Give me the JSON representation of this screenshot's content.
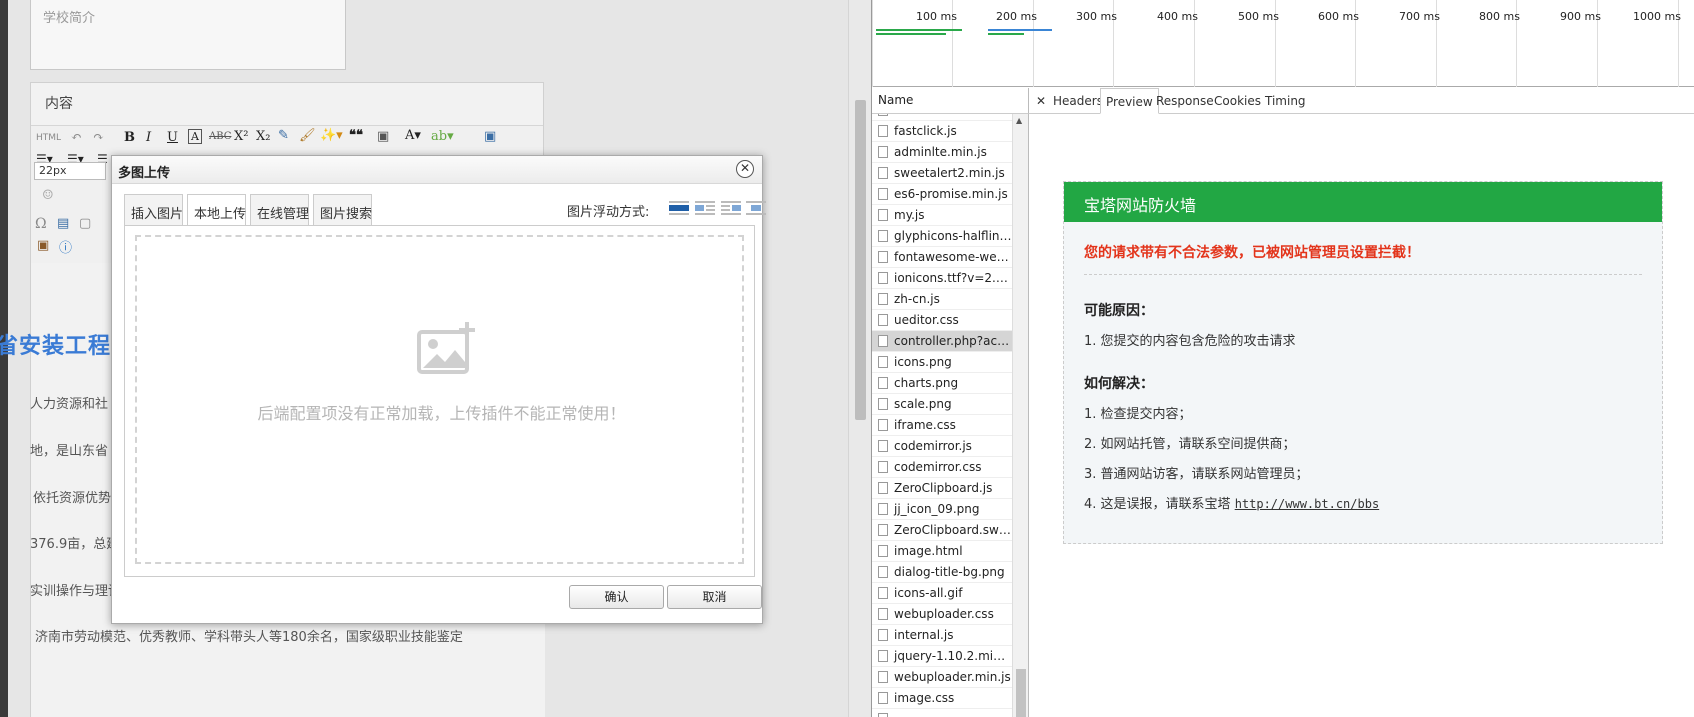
{
  "editor": {
    "intro_placeholder": "学校简介",
    "content_label": "内容",
    "font_size": "22px",
    "heading_fragment": "省安装工程",
    "paragraphs": [
      "人力资源和社",
      "地，是山东省",
      "依托资源优势",
      "376.9亩，总建",
      "实训操作与理论基础相结合。学校师资力量雄厚，现有教职工460余名，其中高",
      "济南市劳动模范、优秀教师、学科带头人等180余名，国家级职业技能鉴定"
    ]
  },
  "dialog": {
    "title": "多图上传",
    "close_glyph": "✕",
    "tabs": [
      "插入图片",
      "本地上传",
      "在线管理",
      "图片搜索"
    ],
    "active_tab": "本地上传",
    "float_label": "图片浮动方式:",
    "message": "后端配置项没有正常加载，上传插件不能正常使用！",
    "confirm": "确认",
    "cancel": "取消"
  },
  "devtools": {
    "timeline_ticks": [
      "100 ms",
      "200 ms",
      "300 ms",
      "400 ms",
      "500 ms",
      "600 ms",
      "700 ms",
      "800 ms",
      "900 ms",
      "1000 ms"
    ],
    "name_header": "Name",
    "files": [
      "fastclick.js",
      "adminlte.min.js",
      "sweetalert2.min.js",
      "es6-promise.min.js",
      "my.js",
      "glyphicons-halfling...",
      "fontawesome-webf...",
      "ionicons.ttf?v=2.0.0",
      "zh-cn.js",
      "ueditor.css",
      "controller.php?acti...",
      "icons.png",
      "charts.png",
      "scale.png",
      "iframe.css",
      "codemirror.js",
      "codemirror.css",
      "ZeroClipboard.js",
      "jj_icon_09.png",
      "ZeroClipboard.swf?...",
      "image.html",
      "dialog-title-bg.png",
      "icons-all.gif",
      "webuploader.css",
      "internal.js",
      "jquery-1.10.2.min.js",
      "webuploader.min.js",
      "image.css"
    ],
    "selected_file": "controller.php?acti...",
    "detail_close": "✕",
    "detail_tabs": [
      "Headers",
      "Preview",
      "Response",
      "Cookies",
      "Timing"
    ],
    "active_detail_tab": "Preview"
  },
  "firewall": {
    "title": "宝塔网站防火墙",
    "warning": "您的请求带有不合法参数，已被网站管理员设置拦截！",
    "reasons_title": "可能原因：",
    "reasons": [
      "1. 您提交的内容包含危险的攻击请求"
    ],
    "solutions_title": "如何解决：",
    "solutions": [
      "1. 检查提交内容；",
      "2. 如网站托管，请联系空间提供商；",
      "3. 普通网站访客，请联系网站管理员；",
      "4. 这是误报，请联系宝塔"
    ],
    "link": "http://www.bt.cn/bbs",
    "header_color": "#22a744",
    "warning_color": "#e3341b"
  }
}
